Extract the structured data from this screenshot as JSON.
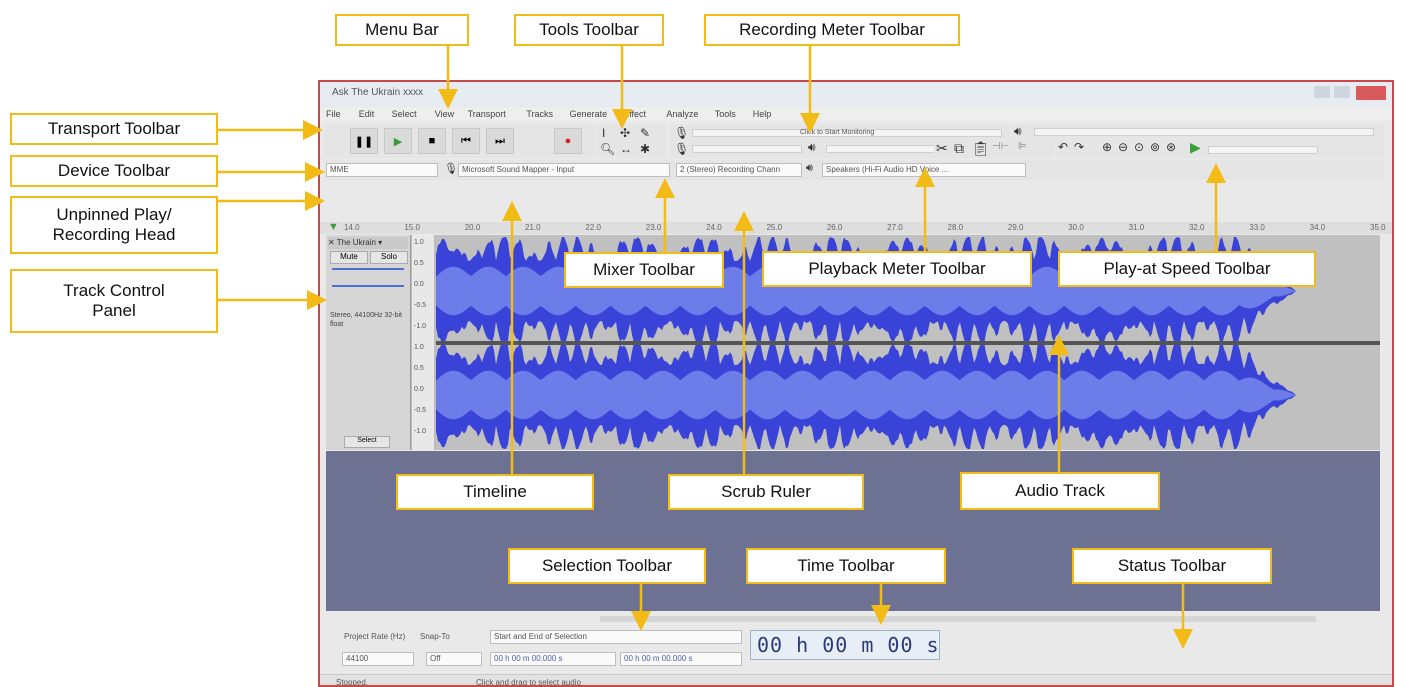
{
  "annotations": {
    "menu_bar": "Menu Bar",
    "tools_toolbar": "Tools Toolbar",
    "recording_meter_toolbar": "Recording Meter Toolbar",
    "transport_toolbar": "Transport Toolbar",
    "device_toolbar": "Device Toolbar",
    "unpinned_head": "Unpinned Play/ Recording Head",
    "track_control_panel": "Track Control Panel",
    "mixer_toolbar": "Mixer Toolbar",
    "playback_meter_toolbar": "Playback Meter Toolbar",
    "play_at_speed_toolbar": "Play-at Speed Toolbar",
    "timeline": "Timeline",
    "scrub_ruler": "Scrub Ruler",
    "audio_track": "Audio Track",
    "selection_toolbar": "Selection Toolbar",
    "time_toolbar": "Time Toolbar",
    "status_toolbar": "Status Toolbar"
  },
  "app": {
    "window_title": "Ask The Ukrain xxxx",
    "menu": [
      "File",
      "Edit",
      "Select",
      "View",
      "Transport",
      "Tracks",
      "Generate",
      "Effect",
      "Analyze",
      "Tools",
      "Help"
    ],
    "meter_hint": "Click to Start Monitoring",
    "device": {
      "host": "MME",
      "recording_device": "Microsoft Sound Mapper - Input",
      "channels": "2 (Stereo) Recording Chann",
      "playback_device": "Speakers (Hi-Fi Audio HD Voice ..."
    },
    "ruler_ticks": [
      "14.0",
      "15.0",
      "20.0",
      "21.0",
      "22.0",
      "23.0",
      "24.0",
      "25.0",
      "26.0",
      "27.0",
      "28.0",
      "29.0",
      "30.0",
      "31.0",
      "32.0",
      "33.0",
      "34.0",
      "35.0"
    ],
    "track": {
      "name": "The Ukrain",
      "mute": "Mute",
      "solo": "Solo",
      "info": "Stereo, 44100Hz 32-bit float",
      "select": "Select",
      "vscale": [
        "1.0",
        "0.5",
        "0.0",
        "-0.5",
        "-1.0",
        "1.0",
        "0.5",
        "0.0",
        "-0.5",
        "-1.0"
      ]
    },
    "selection": {
      "rate_label": "Project Rate (Hz)",
      "snap_label": "Snap-To",
      "rate": "44100",
      "snap": "Off",
      "mode": "Start and End of Selection",
      "start": "00 h 00 m 00.000 s",
      "end": "00 h 00 m 00.000 s"
    },
    "time_display": "00 h 00 m 00 s",
    "status": "Stopped.",
    "status_hint": "Click and drag to select audio"
  }
}
